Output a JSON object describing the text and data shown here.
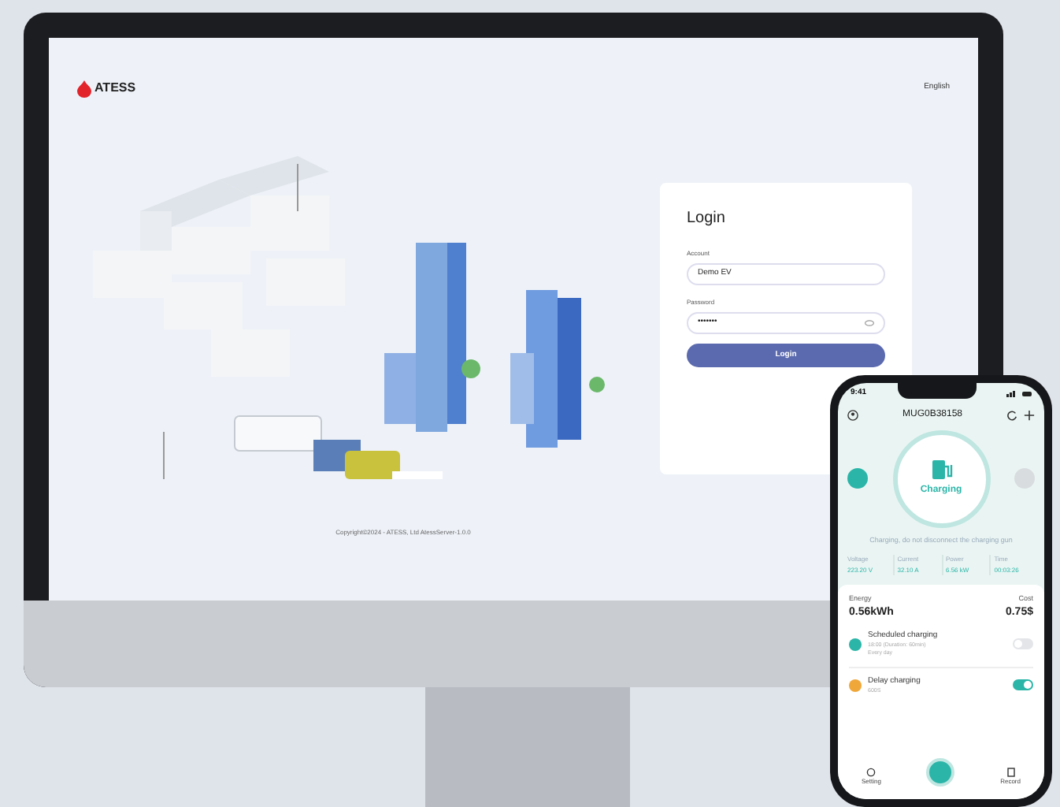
{
  "web": {
    "logo": "ATESS",
    "language": "English",
    "login": {
      "title": "Login",
      "account_label": "Account",
      "account_value": "Demo EV",
      "password_label": "Password",
      "password_value": "•••••••",
      "button": "Login"
    },
    "copyright": "Copyright©2024 - ATESS, Ltd AtessServer-1.0.0"
  },
  "phone": {
    "time": "9:41",
    "device": "MUG0B38158",
    "status": "Charging",
    "message": "Charging, do not disconnect the charging gun",
    "metrics": [
      {
        "label": "Voltage",
        "value": "223.20 V"
      },
      {
        "label": "Current",
        "value": "32.10 A"
      },
      {
        "label": "Power",
        "value": "6.56 kW"
      },
      {
        "label": "Time",
        "value": "00:03:26"
      }
    ],
    "energy": {
      "label": "Energy",
      "value": "0.56kWh"
    },
    "cost": {
      "label": "Cost",
      "value": "0.75$"
    },
    "schedules": [
      {
        "title": "Scheduled charging",
        "detail": "18:00 (Duration: 60min)",
        "repeat": "Every day",
        "on": false,
        "color": "#2bb5a8"
      },
      {
        "title": "Delay charging",
        "detail": "600S",
        "on": true,
        "color": "#f0a73a"
      }
    ],
    "nav": [
      {
        "label": "Setting"
      },
      {
        "label": "Record"
      }
    ]
  }
}
